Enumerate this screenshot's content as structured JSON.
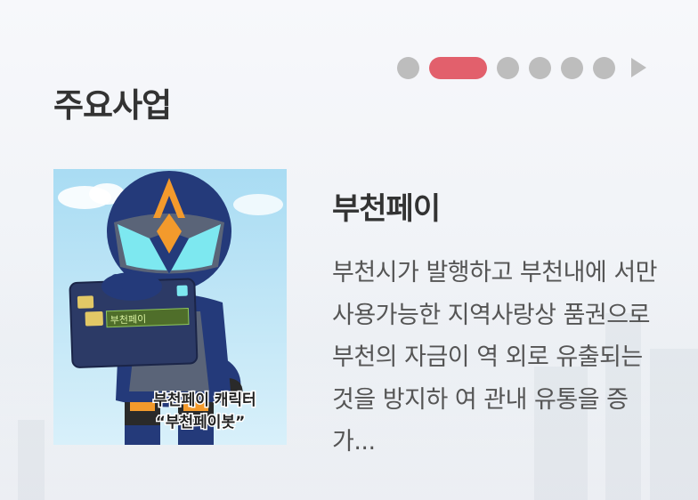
{
  "section": {
    "title": "주요사업"
  },
  "pager": {
    "active_index": 1,
    "dots": [
      "slide-1",
      "slide-2",
      "slide-3",
      "slide-4",
      "slide-5",
      "slide-6"
    ],
    "active_color": "#e2606c",
    "inactive_color": "#bdbdbd",
    "next_icon": "play-arrow-icon"
  },
  "item": {
    "title": "부천페이",
    "description": "부천시가 발행하고 부천내에 서만 사용가능한 지역사랑상 품권으로 부천의 자금이 역 외로 유출되는 것을 방지하 여 관내 유통을 증가...",
    "image": {
      "card_label": "부천페이",
      "caption_line1": "부천페이 캐릭터",
      "caption_line2": "“부천페이봇”"
    }
  }
}
